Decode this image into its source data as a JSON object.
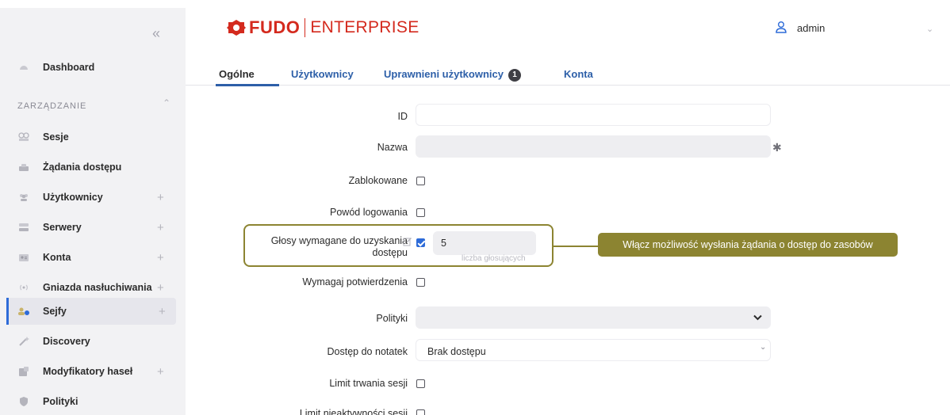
{
  "sidebar": {
    "collapse_icon": "double-chevron-left-icon",
    "dashboard": {
      "label": "Dashboard",
      "icon": "dashboard-icon"
    },
    "section_title": "ZARZĄDZANIE",
    "items": [
      {
        "label": "Sesje",
        "icon": "sessions-icon",
        "expandable": false
      },
      {
        "label": "Żądania dostępu",
        "icon": "access-requests-icon",
        "expandable": false
      },
      {
        "label": "Użytkownicy",
        "icon": "users-icon",
        "expandable": true
      },
      {
        "label": "Serwery",
        "icon": "servers-icon",
        "expandable": true
      },
      {
        "label": "Konta",
        "icon": "accounts-icon",
        "expandable": true
      },
      {
        "label": "Gniazda nasłuchiwania",
        "icon": "listeners-icon",
        "expandable": true
      },
      {
        "label": "Sejfy",
        "icon": "safes-icon",
        "expandable": true,
        "active": true
      },
      {
        "label": "Discovery",
        "icon": "discovery-icon",
        "expandable": false
      },
      {
        "label": "Modyfikatory haseł",
        "icon": "password-modifiers-icon",
        "expandable": true
      },
      {
        "label": "Polityki",
        "icon": "policies-icon",
        "expandable": false
      }
    ],
    "plus": "+"
  },
  "header": {
    "logo_brand": "FUDO",
    "logo_product": "ENTERPRISE",
    "user_name": "admin"
  },
  "tabs": [
    {
      "label": "Ogólne",
      "active": true
    },
    {
      "label": "Użytkownicy",
      "active": false
    },
    {
      "label": "Uprawnieni użytkownicy",
      "active": false,
      "badge": "1"
    },
    {
      "label": "Konta",
      "active": false
    }
  ],
  "form": {
    "id_label": "ID",
    "name_label": "Nazwa",
    "required_mark": "✱",
    "blocked_label": "Zablokowane",
    "login_reason_label": "Powód logowania",
    "votes_label_line1": "Głosy wymagane do uzyskania",
    "votes_label_line2": "dostępu",
    "votes_value": "5",
    "votes_hint": "liczba głosujących",
    "votes_checked": true,
    "require_confirmation_label": "Wymagaj potwierdzenia",
    "policies_label": "Polityki",
    "notes_access_label": "Dostęp do notatek",
    "notes_access_value": "Brak dostępu",
    "session_time_limit_label": "Limit trwania sesji",
    "inactivity_limit_label": "Limit nieaktywności sesji"
  },
  "callout": {
    "text": "Włącz możliwość wysłania żądania o dostęp do zasobów",
    "color": "#8c8431"
  },
  "colors": {
    "brand": "#d42a1e",
    "link": "#2d5fa8",
    "checkbox_checked": "#2d6bd8",
    "sidebar_bg": "#f2f2f4"
  }
}
